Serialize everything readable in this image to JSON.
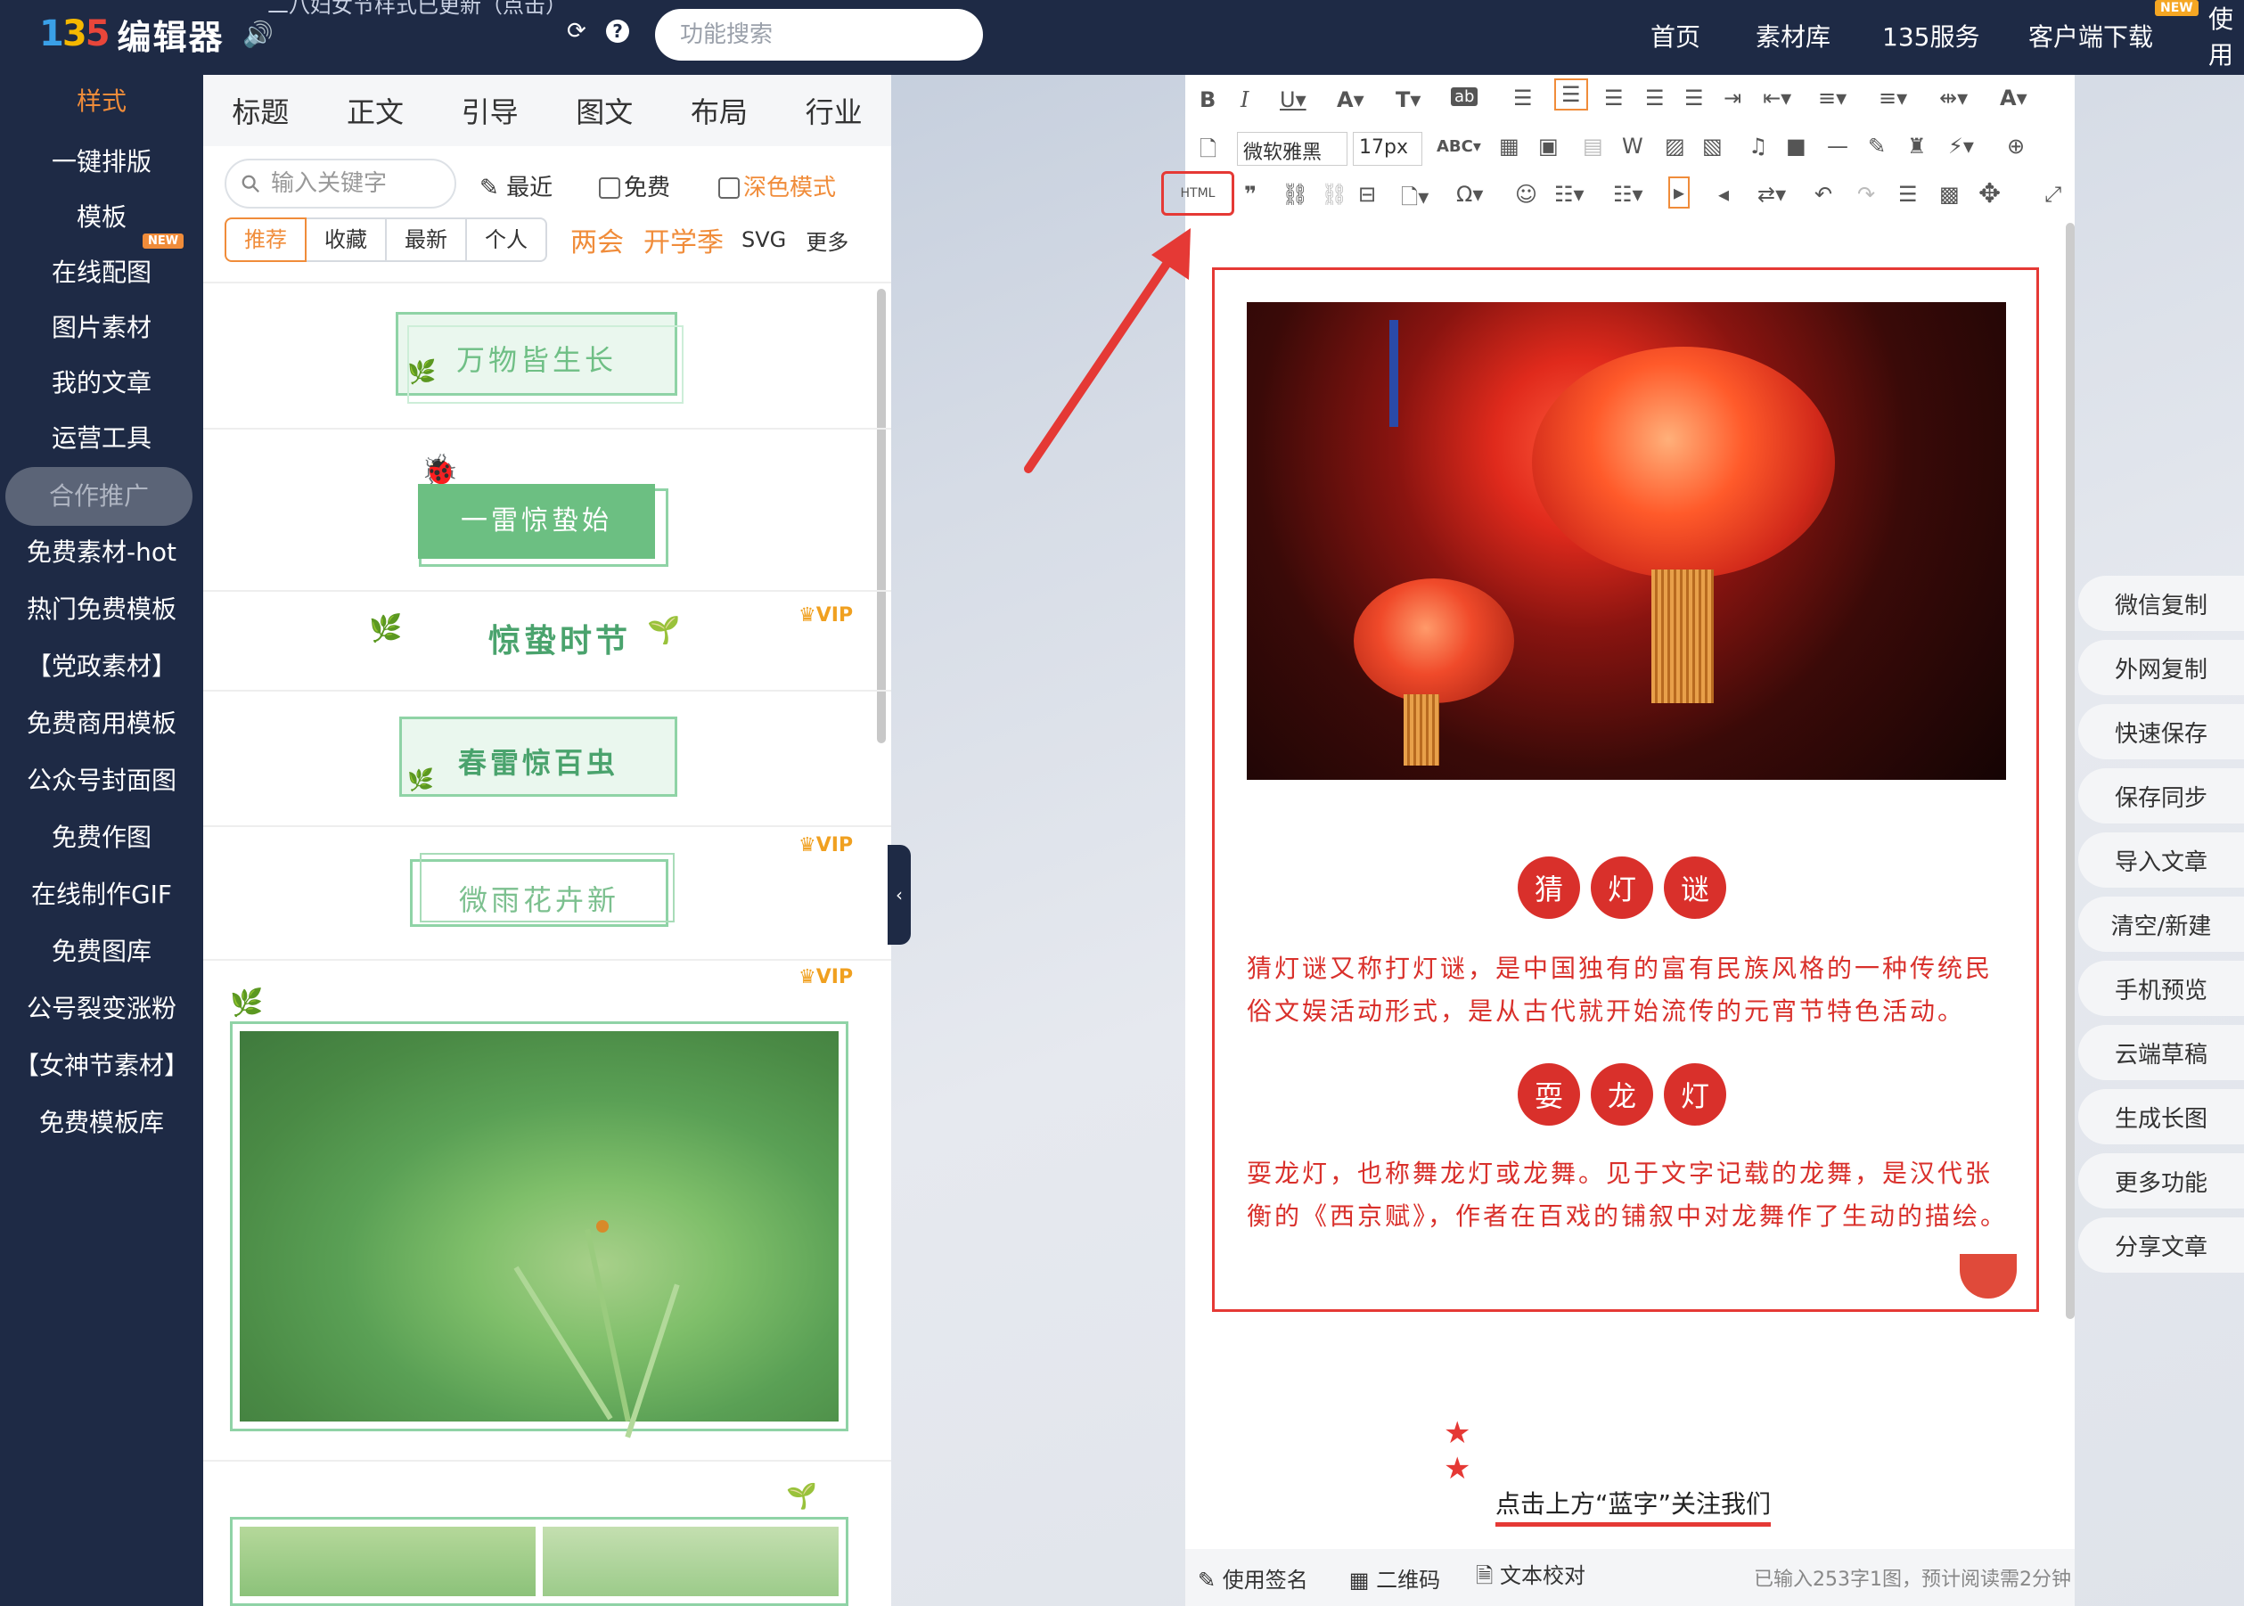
{
  "app": {
    "logo_mark": "135",
    "logo_text": "编辑器",
    "notice": "二八妇女节样式已更新（点击）"
  },
  "search": {
    "placeholder": "功能搜索"
  },
  "nav": {
    "items": [
      "首页",
      "素材库",
      "135服务",
      "客户端下载",
      "使用"
    ],
    "new_badge": "NEW"
  },
  "sidebar": {
    "items": [
      "样式",
      "一键排版",
      "模板",
      "在线配图",
      "图片素材",
      "我的文章",
      "运营工具",
      "合作推广",
      "免费素材-hot",
      "热门免费模板",
      "【党政素材】",
      "免费商用模板",
      "公众号封面图",
      "免费作图",
      "在线制作GIF",
      "免费图库",
      "公号裂变涨粉",
      "【女神节素材】",
      "免费模板库"
    ],
    "new_badge": "NEW"
  },
  "panel": {
    "tabs": [
      "标题",
      "正文",
      "引导",
      "图文",
      "布局",
      "行业"
    ],
    "keyword_placeholder": "输入关键字",
    "recent": "最近",
    "free": "免费",
    "dark_mode": "深色模式",
    "filters": [
      "推荐",
      "收藏",
      "最新",
      "个人"
    ],
    "filter_links": [
      "两会",
      "开学季"
    ],
    "svg": "SVG",
    "more": "更多",
    "vip": "VIP",
    "templates": [
      "万物皆生长",
      "一雷惊蛰始",
      "惊蛰时节",
      "春雷惊百虫",
      "微雨花卉新"
    ]
  },
  "toolbar": {
    "html_label": "HTML",
    "font": "微软雅黑",
    "size": "17px"
  },
  "article": {
    "heading1": [
      "猜",
      "灯",
      "谜"
    ],
    "para1": "猜灯谜又称打灯谜，是中国独有的富有民族风格的一种传统民俗文娱活动形式，是从古代就开始流传的元宵节特色活动。",
    "heading2": [
      "耍",
      "龙",
      "灯"
    ],
    "para2": "耍龙灯，也称舞龙灯或龙舞。见于文字记载的龙舞，是汉代张衡的《西京赋》，作者在百戏的铺叙中对龙舞作了生动的描绘。",
    "follow": "点击上方“蓝字”关注我们"
  },
  "status": {
    "signature": "使用签名",
    "qrcode": "二维码",
    "proofread": "文本校对",
    "count": "已输入253字1图，预计阅读需2分钟"
  },
  "actions": [
    "微信复制",
    "外网复制",
    "快速保存",
    "保存同步",
    "导入文章",
    "清空/新建",
    "手机预览",
    "云端草稿",
    "生成长图",
    "更多功能",
    "分享文章"
  ],
  "colors": {
    "sidebar": "#1e2a45",
    "accent": "#f08c3a",
    "article_red": "#d9302b",
    "template_green": "#4aa36d"
  }
}
